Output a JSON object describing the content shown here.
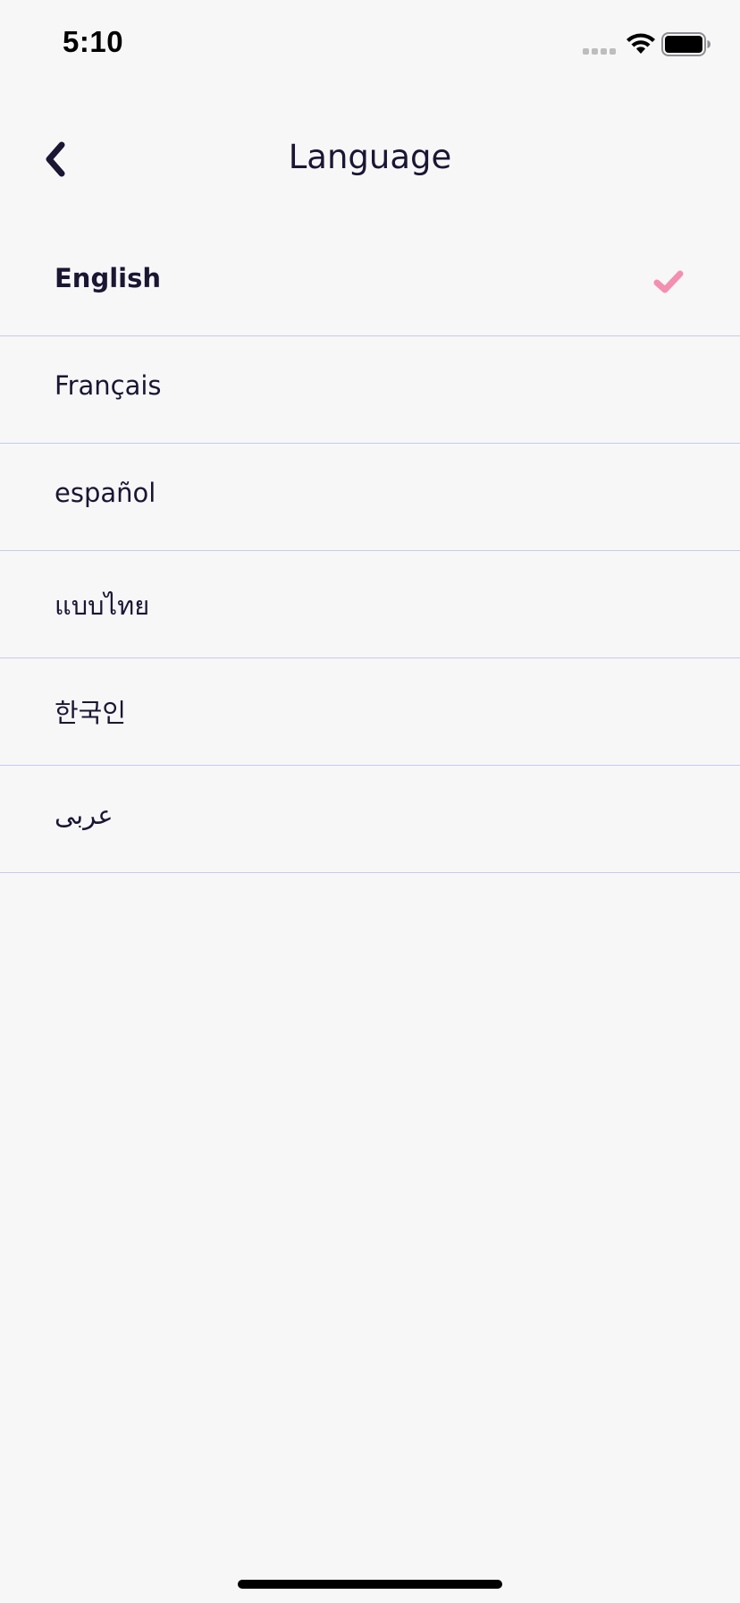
{
  "status_bar": {
    "time": "5:10"
  },
  "header": {
    "title": "Language",
    "back_icon": "chevron-left-icon"
  },
  "languages": [
    {
      "label": "English",
      "selected": true
    },
    {
      "label": "Français",
      "selected": false
    },
    {
      "label": "español",
      "selected": false
    },
    {
      "label": "แบบไทย",
      "selected": false
    },
    {
      "label": "한국인",
      "selected": false
    },
    {
      "label": "عربى",
      "selected": false
    }
  ],
  "colors": {
    "accent_check": "#f48fb1",
    "text": "#1a1633",
    "divider": "#c9c8ee",
    "background": "#f7f7f8"
  }
}
